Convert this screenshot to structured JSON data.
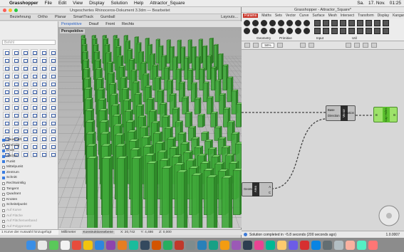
{
  "menubar": {
    "app": "Grasshopper",
    "items": [
      "File",
      "Edit",
      "View",
      "Display",
      "Solution",
      "Help",
      "Attractor_Square"
    ],
    "day": "Sa.",
    "date": "17. Nov.",
    "time": "01:25"
  },
  "rhino": {
    "window_title": "Ungeschertes Rhinoceros-Dokument 3.3dm — Bearbeitet",
    "tabs": [
      "Beziehnung",
      "Ortho",
      "Planar",
      "SmartTrack",
      "Gumball",
      "Layouts..."
    ],
    "search_placeholder": "Befehl",
    "viewport_tabs": [
      "Perspektive",
      "Drauf",
      "Front",
      "Rechts"
    ],
    "viewport_label": "Perspektive",
    "osnaps": [
      {
        "label": "Dauerhaft",
        "on": true
      },
      {
        "label": "Einmalig",
        "on": false
      },
      {
        "label": "Ende",
        "on": true
      },
      {
        "label": "Nächst",
        "on": true
      },
      {
        "label": "Punkt",
        "on": true
      },
      {
        "label": "Mittelpunkt",
        "on": false
      },
      {
        "label": "Zentrum",
        "on": true
      },
      {
        "label": "Schnitt",
        "on": true
      },
      {
        "label": "Rechtwinklig",
        "on": false
      },
      {
        "label": "Tangent",
        "on": false
      },
      {
        "label": "Quadrant",
        "on": false
      },
      {
        "label": "Knoten",
        "on": false
      },
      {
        "label": "Scheitelpunkt",
        "on": false
      },
      {
        "label": "Auf Kurve",
        "on": false
      },
      {
        "label": "Auf Fläche",
        "on": false
      },
      {
        "label": "Auf Flächenverband",
        "on": false
      },
      {
        "label": "Auf Polygonnetz",
        "on": false
      }
    ],
    "command_line": "1 Kurve der Auswahl hinzugefügt",
    "status": {
      "units": "Millimeter",
      "layer": "Konstruktionsebene",
      "x": "X: 20,742",
      "y": "Y: 4,486",
      "z": "Z: 0,000"
    }
  },
  "grasshopper": {
    "window_title": "Grasshopper - Attractor_Square*",
    "tabs": [
      "Params",
      "Maths",
      "Sets",
      "Vector",
      "Curve",
      "Surface",
      "Mesh",
      "Intersect",
      "Transform",
      "Display",
      "Kangaroo2"
    ],
    "active_tab": "Params",
    "ribbon_groups": [
      "Geometry",
      "Primitive",
      "Input",
      "Util"
    ],
    "zoom": "56%",
    "nodes": {
      "vector": {
        "core": "Vector",
        "inputs": [
          "Base",
          "Direction"
        ],
        "output": "Extrusion"
      },
      "cap": {
        "core": "Cap Holes",
        "input": "B",
        "output": "B"
      },
      "area": {
        "core": "Area",
        "input": "Geometry",
        "outputs": [
          "A",
          "C"
        ]
      }
    },
    "status": "Solution completed in ~5.8 seconds (200 seconds ago)",
    "version": "1.0.0007"
  },
  "colors": {
    "gh_active_tab": "#c9372c",
    "node_selected": "#9de26a",
    "extrusion_green": "#3fa83a"
  }
}
